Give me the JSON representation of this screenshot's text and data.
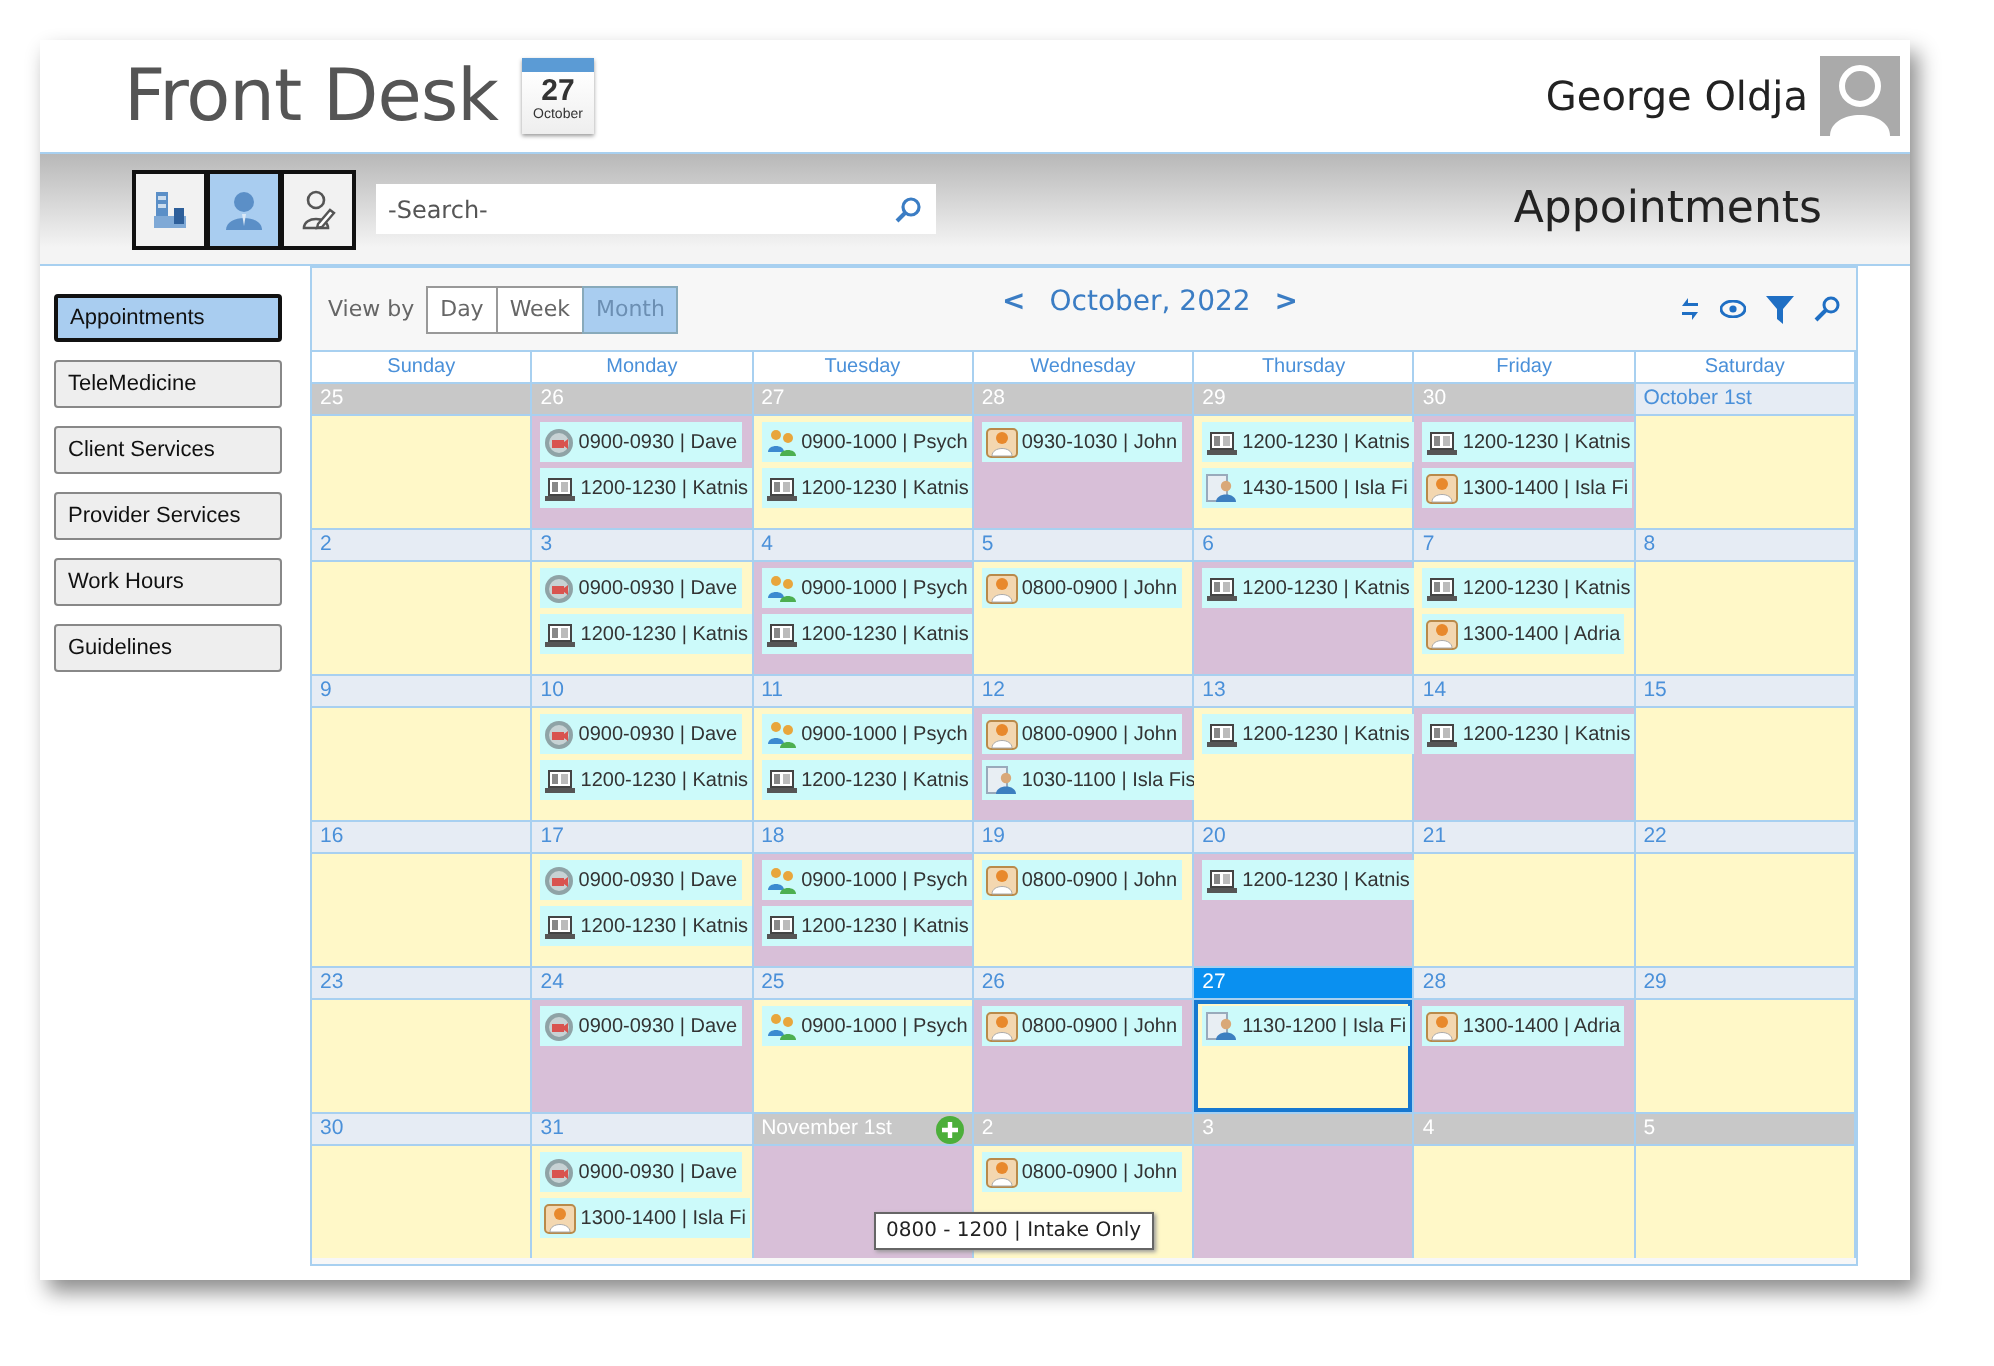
{
  "header": {
    "title": "Front Desk",
    "date_badge": {
      "day": "27",
      "month": "October"
    },
    "user_name": "George Oldja"
  },
  "toolbar": {
    "nav_buttons": [
      {
        "kind": "building",
        "selected": false
      },
      {
        "kind": "person",
        "selected": true
      },
      {
        "kind": "edit",
        "selected": false
      }
    ],
    "search": {
      "placeholder": "-Search-"
    },
    "page_title": "Appointments"
  },
  "sidebar": {
    "items": [
      {
        "label": "Appointments",
        "selected": true
      },
      {
        "label": "TeleMedicine",
        "selected": false
      },
      {
        "label": "Client Services",
        "selected": false
      },
      {
        "label": "Provider Services",
        "selected": false
      },
      {
        "label": "Work Hours",
        "selected": false
      },
      {
        "label": "Guidelines",
        "selected": false
      }
    ]
  },
  "calendar": {
    "view_by_label": "View by",
    "views": [
      {
        "label": "Day",
        "selected": false
      },
      {
        "label": "Week",
        "selected": false
      },
      {
        "label": "Month",
        "selected": true
      }
    ],
    "prev": "<",
    "month_title": "October, 2022",
    "next": ">",
    "weekdays": [
      "Sunday",
      "Monday",
      "Tuesday",
      "Wednesday",
      "Thursday",
      "Friday",
      "Saturday"
    ],
    "weeks": [
      [
        {
          "label": "25",
          "outside": true,
          "today": false,
          "color": "#fff8c8"
        },
        {
          "label": "26",
          "outside": true,
          "today": false,
          "color": "#d8bfd8",
          "appointments": [
            {
              "kind": "video",
              "text": "0900-0930 | Dave"
            },
            {
              "kind": "laptop",
              "text": "1200-1230 | Katnis"
            }
          ]
        },
        {
          "label": "27",
          "outside": true,
          "today": false,
          "color": "#fff8c8",
          "appointments": [
            {
              "kind": "group",
              "text": "0900-1000 | Psych"
            },
            {
              "kind": "laptop",
              "text": "1200-1230 | Katnis"
            }
          ]
        },
        {
          "label": "28",
          "outside": true,
          "today": false,
          "color": "#d8bfd8",
          "appointments": [
            {
              "kind": "doctor",
              "text": "0930-1030 | John"
            }
          ]
        },
        {
          "label": "29",
          "outside": true,
          "today": false,
          "color": "#fff8c8",
          "appointments": [
            {
              "kind": "laptop",
              "text": "1200-1230 | Katnis"
            },
            {
              "kind": "patient",
              "text": "1430-1500 | Isla Fi"
            }
          ]
        },
        {
          "label": "30",
          "outside": true,
          "today": false,
          "color": "#d8bfd8",
          "appointments": [
            {
              "kind": "laptop",
              "text": "1200-1230 | Katnis"
            },
            {
              "kind": "doctor",
              "text": "1300-1400 | Isla Fi"
            }
          ]
        },
        {
          "label": "October 1st",
          "outside": false,
          "today": false,
          "color": "#fff8c8"
        }
      ],
      [
        {
          "label": "2",
          "outside": false,
          "today": false,
          "color": "#fff8c8"
        },
        {
          "label": "3",
          "outside": false,
          "today": false,
          "color": "#fff8c8",
          "appointments": [
            {
              "kind": "video",
              "text": "0900-0930 | Dave"
            },
            {
              "kind": "laptop",
              "text": "1200-1230 | Katnis"
            }
          ]
        },
        {
          "label": "4",
          "outside": false,
          "today": false,
          "color": "#d8bfd8",
          "appointments": [
            {
              "kind": "group",
              "text": "0900-1000 | Psych"
            },
            {
              "kind": "laptop",
              "text": "1200-1230 | Katnis"
            }
          ]
        },
        {
          "label": "5",
          "outside": false,
          "today": false,
          "color": "#fff8c8",
          "appointments": [
            {
              "kind": "doctor",
              "text": "0800-0900 | John"
            }
          ]
        },
        {
          "label": "6",
          "outside": false,
          "today": false,
          "color": "#d8bfd8",
          "appointments": [
            {
              "kind": "laptop",
              "text": "1200-1230 | Katnis"
            }
          ]
        },
        {
          "label": "7",
          "outside": false,
          "today": false,
          "color": "#fff8c8",
          "appointments": [
            {
              "kind": "laptop",
              "text": "1200-1230 | Katnis"
            },
            {
              "kind": "doctor",
              "text": "1300-1400 | Adria"
            }
          ]
        },
        {
          "label": "8",
          "outside": false,
          "today": false,
          "color": "#fff8c8"
        }
      ],
      [
        {
          "label": "9",
          "outside": false,
          "today": false,
          "color": "#fff8c8"
        },
        {
          "label": "10",
          "outside": false,
          "today": false,
          "color": "#fff8c8",
          "appointments": [
            {
              "kind": "video",
              "text": "0900-0930 | Dave"
            },
            {
              "kind": "laptop",
              "text": "1200-1230 | Katnis"
            }
          ]
        },
        {
          "label": "11",
          "outside": false,
          "today": false,
          "color": "#fff8c8",
          "appointments": [
            {
              "kind": "group",
              "text": "0900-1000 | Psych"
            },
            {
              "kind": "laptop",
              "text": "1200-1230 | Katnis"
            }
          ]
        },
        {
          "label": "12",
          "outside": false,
          "today": false,
          "color": "#d8bfd8",
          "appointments": [
            {
              "kind": "doctor",
              "text": "0800-0900 | John"
            },
            {
              "kind": "patient",
              "text": "1030-1100 | Isla Fis"
            }
          ]
        },
        {
          "label": "13",
          "outside": false,
          "today": false,
          "color": "#fff8c8",
          "appointments": [
            {
              "kind": "laptop",
              "text": "1200-1230 | Katnis"
            }
          ]
        },
        {
          "label": "14",
          "outside": false,
          "today": false,
          "color": "#d8bfd8",
          "appointments": [
            {
              "kind": "laptop",
              "text": "1200-1230 | Katnis"
            }
          ]
        },
        {
          "label": "15",
          "outside": false,
          "today": false,
          "color": "#fff8c8"
        }
      ],
      [
        {
          "label": "16",
          "outside": false,
          "today": false,
          "color": "#fff8c8"
        },
        {
          "label": "17",
          "outside": false,
          "today": false,
          "color": "#fff8c8",
          "appointments": [
            {
              "kind": "video",
              "text": "0900-0930 | Dave"
            },
            {
              "kind": "laptop",
              "text": "1200-1230 | Katnis"
            }
          ]
        },
        {
          "label": "18",
          "outside": false,
          "today": false,
          "color": "#d8bfd8",
          "appointments": [
            {
              "kind": "group",
              "text": "0900-1000 | Psych"
            },
            {
              "kind": "laptop",
              "text": "1200-1230 | Katnis"
            }
          ]
        },
        {
          "label": "19",
          "outside": false,
          "today": false,
          "color": "#fff8c8",
          "appointments": [
            {
              "kind": "doctor",
              "text": "0800-0900 | John"
            }
          ]
        },
        {
          "label": "20",
          "outside": false,
          "today": false,
          "color": "#d8bfd8",
          "appointments": [
            {
              "kind": "laptop",
              "text": "1200-1230 | Katnis"
            }
          ]
        },
        {
          "label": "21",
          "outside": false,
          "today": false,
          "color": "#fff8c8"
        },
        {
          "label": "22",
          "outside": false,
          "today": false,
          "color": "#fff8c8"
        }
      ],
      [
        {
          "label": "23",
          "outside": false,
          "today": false,
          "color": "#fff8c8"
        },
        {
          "label": "24",
          "outside": false,
          "today": false,
          "color": "#d8bfd8",
          "appointments": [
            {
              "kind": "video",
              "text": "0900-0930 | Dave"
            }
          ]
        },
        {
          "label": "25",
          "outside": false,
          "today": false,
          "color": "#fff8c8",
          "appointments": [
            {
              "kind": "group",
              "text": "0900-1000 | Psych"
            }
          ]
        },
        {
          "label": "26",
          "outside": false,
          "today": false,
          "color": "#d8bfd8",
          "appointments": [
            {
              "kind": "doctor",
              "text": "0800-0900 | John"
            }
          ]
        },
        {
          "label": "27",
          "outside": false,
          "today": true,
          "color": "#fff8c8",
          "appointments": [
            {
              "kind": "patient",
              "text": "1130-1200 | Isla Fi"
            }
          ]
        },
        {
          "label": "28",
          "outside": false,
          "today": false,
          "color": "#d8bfd8",
          "appointments": [
            {
              "kind": "doctor",
              "text": "1300-1400 | Adria"
            }
          ]
        },
        {
          "label": "29",
          "outside": false,
          "today": false,
          "color": "#fff8c8"
        }
      ],
      [
        {
          "label": "30",
          "outside": false,
          "today": false,
          "color": "#fff8c8"
        },
        {
          "label": "31",
          "outside": false,
          "today": false,
          "color": "#fff8c8",
          "appointments": [
            {
              "kind": "video",
              "text": "0900-0930 | Dave"
            },
            {
              "kind": "doctor",
              "text": "1300-1400 | Isla Fi"
            }
          ]
        },
        {
          "label": "November 1st",
          "outside": true,
          "today": false,
          "add_button": true,
          "color": "#d8bfd8"
        },
        {
          "label": "2",
          "outside": true,
          "today": false,
          "color": "#fff8c8",
          "appointments": [
            {
              "kind": "doctor",
              "text": "0800-0900 | John"
            }
          ]
        },
        {
          "label": "3",
          "outside": true,
          "today": false,
          "color": "#d8bfd8"
        },
        {
          "label": "4",
          "outside": true,
          "today": false,
          "color": "#fff8c8"
        },
        {
          "label": "5",
          "outside": true,
          "today": false,
          "color": "#fff8c8"
        }
      ]
    ],
    "tooltip": "0800 - 1200 | Intake Only"
  }
}
